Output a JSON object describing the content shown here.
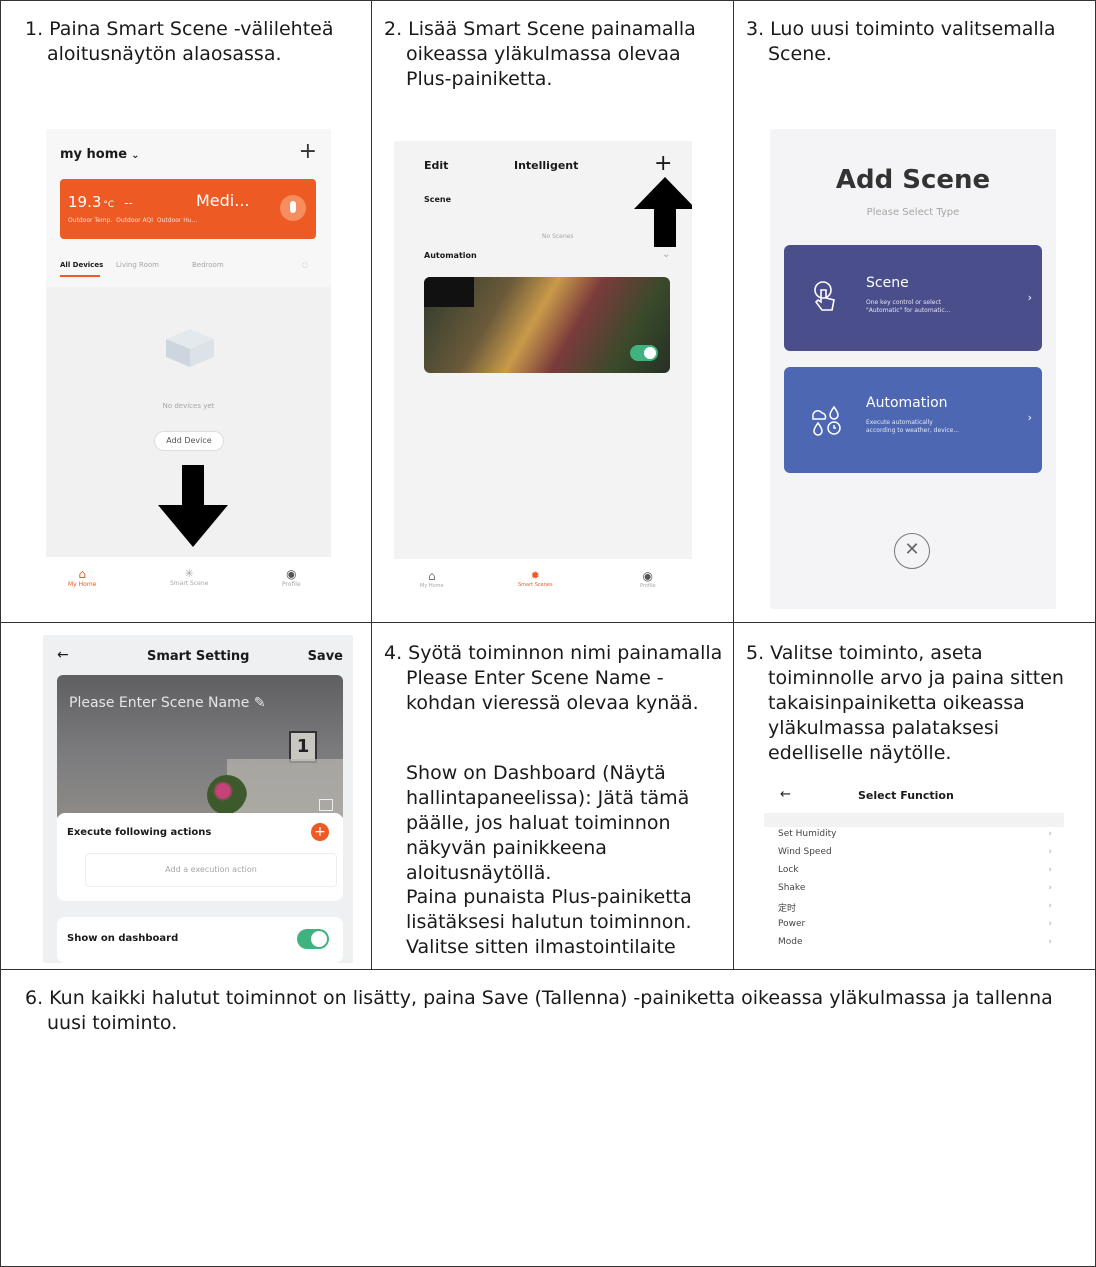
{
  "steps": {
    "s1": "1. Paina Smart Scene -välilehteä aloitusnäytön alaosassa.",
    "s2": "2. Lisää Smart Scene painamalla oikeassa yläkulmassa olevaa Plus-painiketta.",
    "s3": "3. Luo uusi toiminto valitsemalla Scene.",
    "s4": "4. Syötä toiminnon nimi painamalla Please Enter Scene Name -kohdan vieressä olevaa kynää.",
    "s4_p2": "Show on Dashboard (Näytä hallintapaneelissa): Jätä tämä päälle, jos haluat toiminnon näkyvän painikkeena aloitusnäytöllä.",
    "s4_p3": "Paina punaista Plus-painiketta lisätäksesi halutun toiminnon. Valitse sitten ilmastointilaite",
    "s5": "5. Valitse toiminto, aseta toiminnolle arvo ja paina sitten takaisinpainiketta oikeassa yläkulmassa palataksesi edelliselle näytölle.",
    "s6": "6. Kun kaikki halutut toiminnot on lisätty, paina Save (Tallenna) -painiketta oikeassa yläkulmassa ja tallenna uusi toiminto."
  },
  "screen1": {
    "home_title": "my home",
    "temp": "19.3",
    "temp_unit": "°C",
    "dash": "--",
    "medi": "Medi...",
    "sub1": "Outdoor Temp.",
    "sub2": "Outdoor AQI",
    "sub3": "Outdoor Hu...",
    "tabs": [
      "All Devices",
      "Living Room",
      "Bedroom"
    ],
    "no_devices": "No devices yet",
    "add_device": "Add Device",
    "nav": [
      "My Home",
      "Smart Scene",
      "Profile"
    ]
  },
  "screen2": {
    "edit": "Edit",
    "title": "Intelligent",
    "scene": "Scene",
    "no_scenes": "No Scenes",
    "automation": "Automation",
    "nav": [
      "My Home",
      "Smart Scenes",
      "Profile"
    ]
  },
  "screen3": {
    "title": "Add Scene",
    "subtitle": "Please Select Type",
    "card1_title": "Scene",
    "card1_desc1": "One key control or select",
    "card1_desc2": "\"Automatic\" for automatic...",
    "card2_title": "Automation",
    "card2_desc1": "Execute automatically",
    "card2_desc2": "according to weather, device..."
  },
  "screen4": {
    "title": "Smart Setting",
    "save": "Save",
    "placeholder": "Please Enter Scene Name",
    "box_number": "1",
    "execute": "Execute following actions",
    "add_action": "Add a execution action",
    "show_dashboard": "Show on dashboard"
  },
  "screen5": {
    "title": "Select Function",
    "items": [
      "Set Humidity",
      "Wind Speed",
      "Lock",
      "Shake",
      "定时",
      "Power",
      "Mode"
    ]
  },
  "colors": {
    "orange": "#ee5a24",
    "orange_light": "#f47a3a",
    "scene_card": "#4a4f8c",
    "automation_card": "#4d67b3",
    "toggle_green": "#3fb27f",
    "border": "#333333"
  }
}
